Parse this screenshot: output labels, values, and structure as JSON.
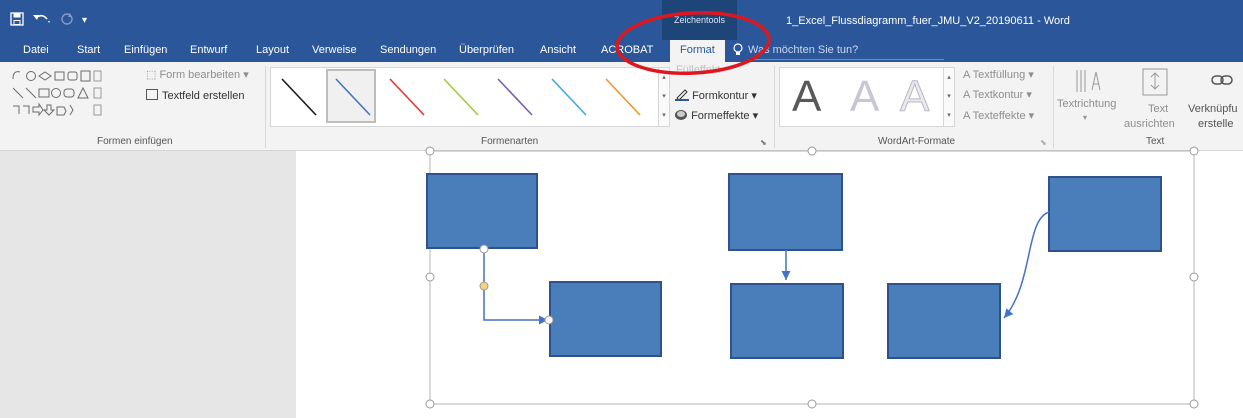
{
  "app": {
    "quick_access_arrow": "▾",
    "context_group": "Zeichentools",
    "document_title": "1_Excel_Flussdiagramm_fuer_JMU_V2_20190611 - Word"
  },
  "tabs": [
    "Datei",
    "Start",
    "Einfügen",
    "Entwurf",
    "Layout",
    "Verweise",
    "Sendungen",
    "Überprüfen",
    "Ansicht",
    "ACROBAT",
    "Format"
  ],
  "active_tab": "Format",
  "tell_me": "Was möchten Sie tun?",
  "ribbon": {
    "insert_shapes": {
      "label": "Formen einfügen",
      "edit_shape": "Form bearbeiten",
      "draw_textbox": "Textfeld erstellen"
    },
    "shape_styles": {
      "label": "Formenarten",
      "fill_partial": "Fülleffekt",
      "outline": "Formkontur",
      "effects": "Formeffekte",
      "line_colors": [
        "#1a1a1a",
        "#4472c4",
        "#e0382b",
        "#a8c83a",
        "#7a5cb0",
        "#3fa8e0",
        "#f0962e"
      ]
    },
    "wordart": {
      "label": "WordArt-Formate",
      "glyph": "A",
      "text_fill": "Textfüllung",
      "text_outline": "Textkontur",
      "text_effects": "Texteffekte"
    },
    "text": {
      "label": "Text",
      "direction": "Textrichtung",
      "align_1": "Text",
      "align_2": "ausrichten",
      "link_1": "Verknüpfu",
      "link_2": "erstelle"
    }
  },
  "colors": {
    "title_bar": "#2b579a",
    "context_group": "#1d4577",
    "shape_fill": "#4a7ebb",
    "shape_border": "#2f528f",
    "connector": "#4472c4",
    "highlight_ellipse": "#e0161f",
    "adjust_handle": "#f6d27a"
  }
}
